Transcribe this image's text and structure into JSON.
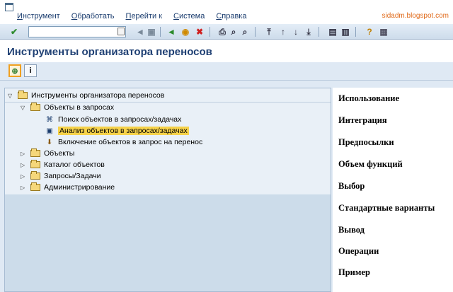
{
  "menu": {
    "items": [
      {
        "acc": "И",
        "rest": "нструмент"
      },
      {
        "acc": "О",
        "rest": "бработать"
      },
      {
        "acc": "П",
        "rest": "ерейти к"
      },
      {
        "acc": "С",
        "rest": "истема"
      },
      {
        "acc": "С",
        "rest": "правка"
      }
    ],
    "watermark": "sidadm.blogspot.com"
  },
  "toolbar": {
    "command_value": ""
  },
  "title": "Инструменты организатора переносов",
  "tree": {
    "root": "Инструменты организатора переносов",
    "group_objects_in_requests": "Объекты в запросах",
    "leaf_search": "Поиск объектов в запросах/задачах",
    "leaf_analysis": "Анализ объектов в запросах/задачах",
    "leaf_include": "Включение объектов в запрос на перенос",
    "node_objects": "Объекты",
    "node_catalog": "Каталог объектов",
    "node_requests": "Запросы/Задачи",
    "node_admin": "Администрирование"
  },
  "doc": {
    "headings": [
      "Использование",
      "Интеграция",
      "Предпосылки",
      "Объем функций",
      "Выбор",
      "Стандартные варианты",
      "Вывод",
      "Операции",
      "Пример"
    ]
  },
  "colors": {
    "title": "#1e3f73",
    "selection": "#f6d24a",
    "watermark": "#e06a1a"
  }
}
